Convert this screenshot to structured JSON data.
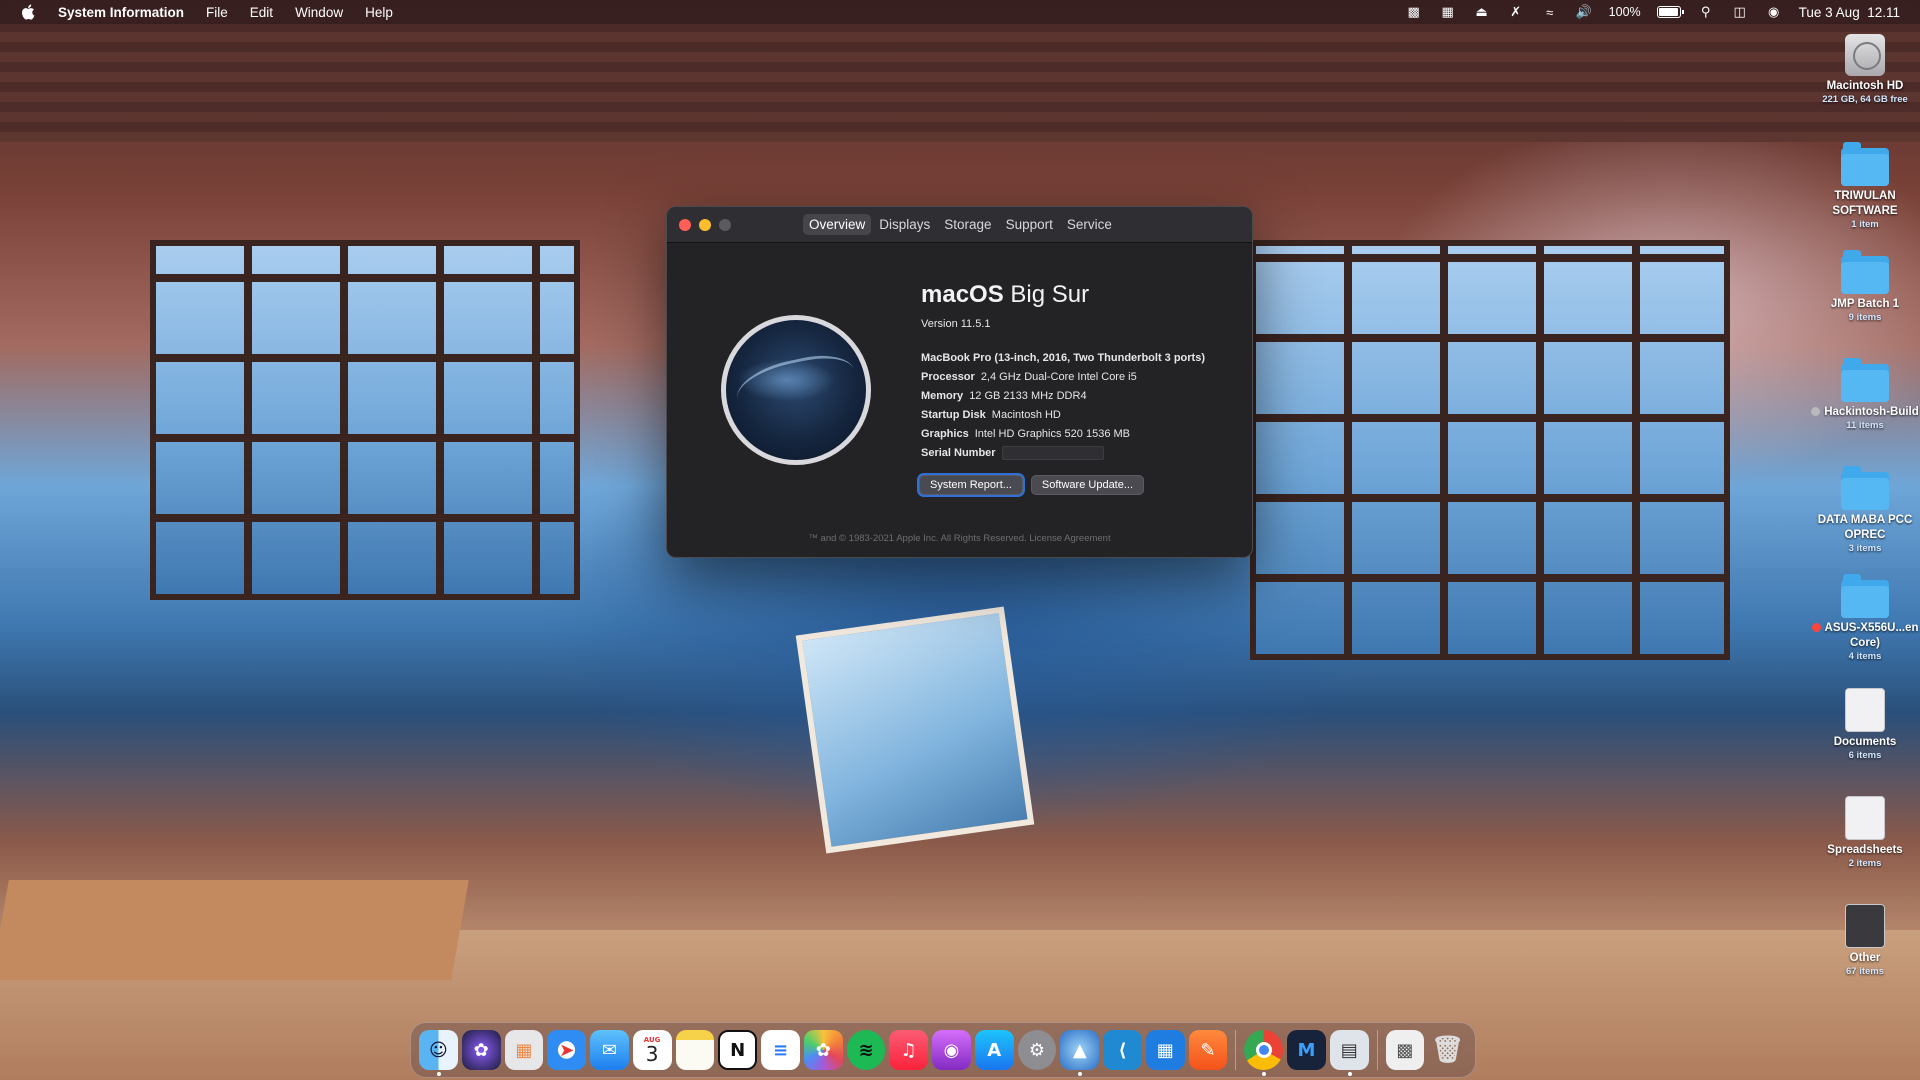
{
  "menubar": {
    "app_name": "System Information",
    "menus": [
      "File",
      "Edit",
      "Window",
      "Help"
    ],
    "battery_percent": "100%",
    "battery_level": 1.0,
    "datetime": "Tue 3 Aug  12.11"
  },
  "window": {
    "tabs": [
      "Overview",
      "Displays",
      "Storage",
      "Support",
      "Service"
    ],
    "active_tab": "Overview",
    "os_name_bold": "macOS",
    "os_name_rest": " Big Sur",
    "version": "Version 11.5.1",
    "model": "MacBook Pro (13-inch, 2016, Two Thunderbolt 3 ports)",
    "specs": {
      "processor_label": "Processor",
      "processor_value": "2,4 GHz Dual-Core Intel Core i5",
      "memory_label": "Memory",
      "memory_value": "12 GB 2133 MHz DDR4",
      "startup_label": "Startup Disk",
      "startup_value": "Macintosh HD",
      "graphics_label": "Graphics",
      "graphics_value": "Intel HD Graphics 520 1536 MB",
      "serial_label": "Serial Number"
    },
    "buttons": {
      "system_report": "System Report...",
      "software_update": "Software Update..."
    },
    "footer": "™ and © 1983-2021 Apple Inc. All Rights Reserved. License Agreement"
  },
  "desktop_icons": [
    {
      "name": "Macintosh HD",
      "sub": "221 GB, 64 GB free",
      "type": "drive"
    },
    {
      "name": "TRIWULAN SOFTWARE",
      "sub": "1 item",
      "type": "folder"
    },
    {
      "name": "JMP Batch 1",
      "sub": "9 items",
      "type": "folder"
    },
    {
      "name": "Hackintosh-Build",
      "sub": "11 items",
      "type": "folder",
      "tag": "#b9b9bd"
    },
    {
      "name": "DATA MABA PCC OPREC",
      "sub": "3 items",
      "type": "folder"
    },
    {
      "name": "ASUS-X556U...en Core)",
      "sub": "4 items",
      "type": "folder",
      "tag": "#ff453a"
    },
    {
      "name": "Documents",
      "sub": "6 items",
      "type": "stack"
    },
    {
      "name": "Spreadsheets",
      "sub": "2 items",
      "type": "stack"
    },
    {
      "name": "Other",
      "sub": "67 items",
      "type": "stack"
    }
  ],
  "dock": {
    "calendar_month": "AUG",
    "calendar_day": "3"
  }
}
